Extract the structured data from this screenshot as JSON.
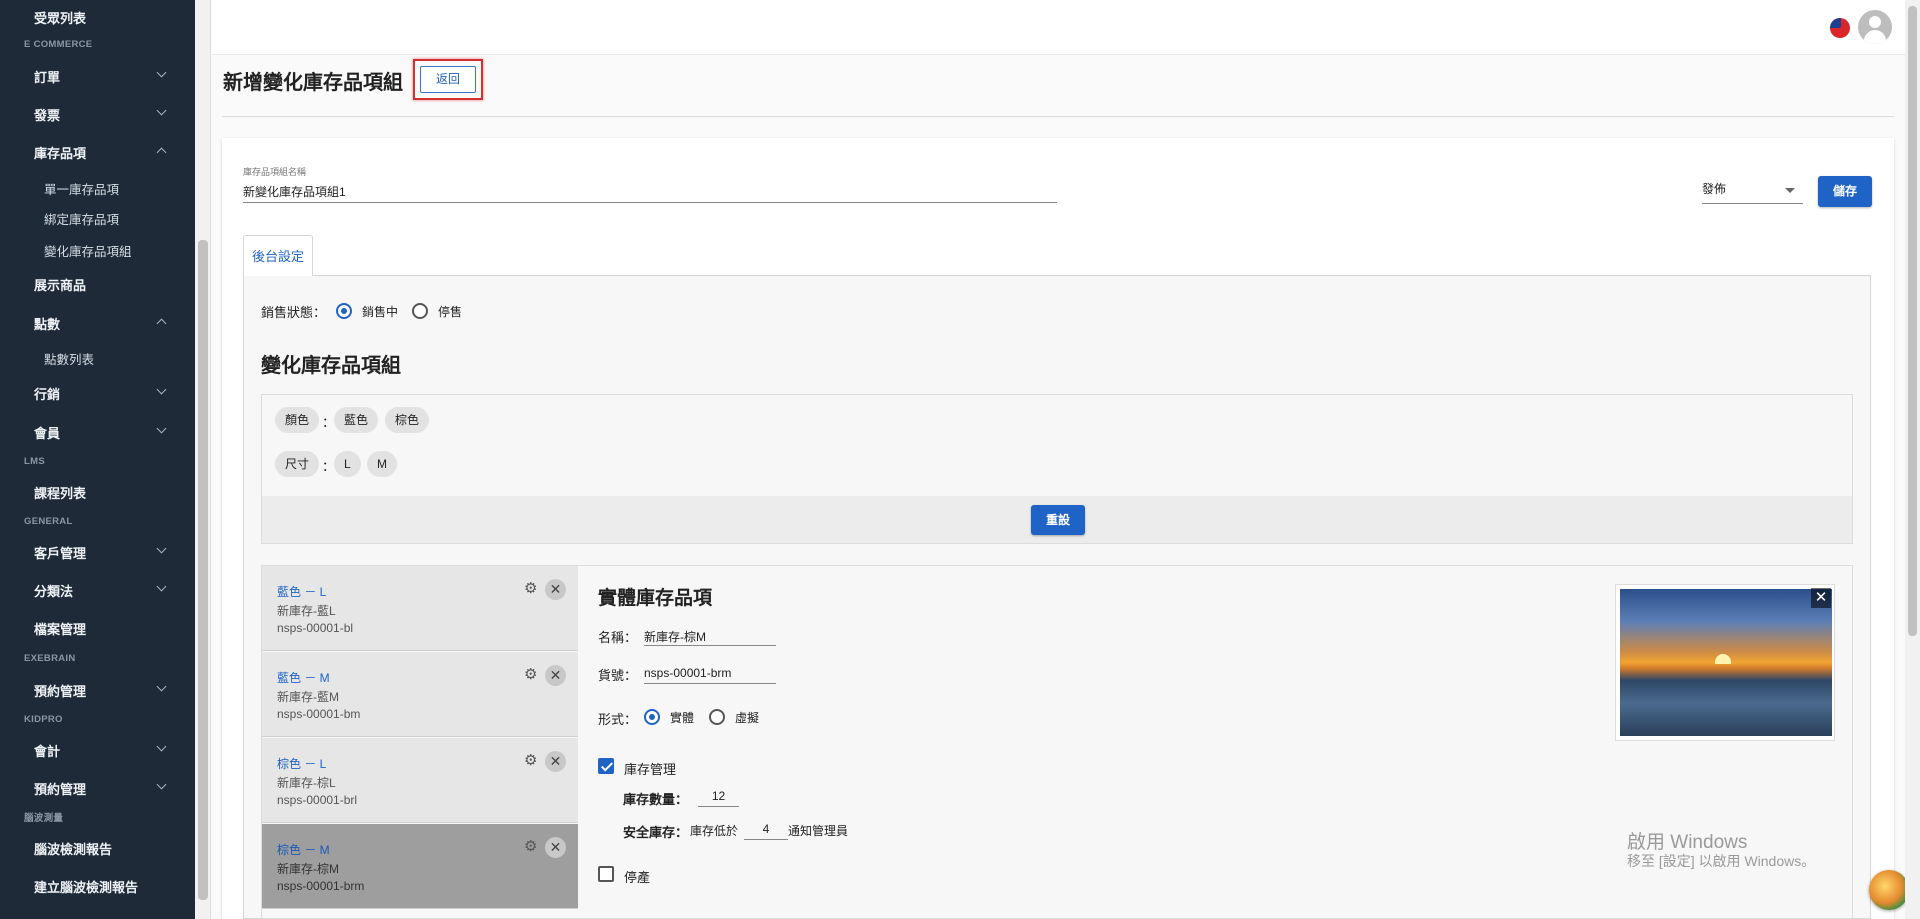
{
  "sidebar": {
    "items": [
      {
        "label": "受眾列表",
        "kind": "item"
      },
      {
        "label": "E COMMERCE",
        "kind": "section"
      },
      {
        "label": "訂單",
        "kind": "item",
        "chevron": "down"
      },
      {
        "label": "發票",
        "kind": "item",
        "chevron": "down"
      },
      {
        "label": "庫存品項",
        "kind": "item",
        "chevron": "up"
      },
      {
        "label": "單一庫存品項",
        "kind": "sub"
      },
      {
        "label": "綁定庫存品項",
        "kind": "sub"
      },
      {
        "label": "變化庫存品項組",
        "kind": "sub"
      },
      {
        "label": "展示商品",
        "kind": "item"
      },
      {
        "label": "點數",
        "kind": "item",
        "chevron": "up"
      },
      {
        "label": "點數列表",
        "kind": "sub"
      },
      {
        "label": "行銷",
        "kind": "item",
        "chevron": "down"
      },
      {
        "label": "會員",
        "kind": "item",
        "chevron": "down"
      },
      {
        "label": "LMS",
        "kind": "section"
      },
      {
        "label": "課程列表",
        "kind": "item"
      },
      {
        "label": "GENERAL",
        "kind": "section"
      },
      {
        "label": "客戶管理",
        "kind": "item",
        "chevron": "down"
      },
      {
        "label": "分類法",
        "kind": "item",
        "chevron": "down"
      },
      {
        "label": "檔案管理",
        "kind": "item"
      },
      {
        "label": "EXEBRAIN",
        "kind": "section"
      },
      {
        "label": "預約管理",
        "kind": "item",
        "chevron": "down"
      },
      {
        "label": "KIDPRO",
        "kind": "section"
      },
      {
        "label": "會計",
        "kind": "item",
        "chevron": "down"
      },
      {
        "label": "預約管理",
        "kind": "item",
        "chevron": "down"
      },
      {
        "label": "腦波測量",
        "kind": "section"
      },
      {
        "label": "腦波檢測報告",
        "kind": "item"
      },
      {
        "label": "建立腦波檢測報告",
        "kind": "item"
      }
    ]
  },
  "header": {
    "title": "新增變化庫存品項組",
    "back_label": "返回"
  },
  "form": {
    "name_label": "庫存品項組名稱",
    "name_value": "新變化庫存品項組1",
    "publish_value": "發佈",
    "save_label": "儲存",
    "tab_label": "後台設定",
    "sale_status_label": "銷售狀態：",
    "sale_options": [
      "銷售中",
      "停售"
    ],
    "sale_selected": 0
  },
  "variant_group": {
    "title": "變化庫存品項組",
    "attributes": [
      {
        "name": "顏色",
        "values": [
          "藍色",
          "棕色"
        ]
      },
      {
        "name": "尺寸",
        "values": [
          "L",
          "M"
        ]
      }
    ],
    "colon": "：",
    "reset_label": "重設"
  },
  "variants": [
    {
      "name": "藍色 － L",
      "title": "新庫存-藍L",
      "sku": "nsps-00001-bl",
      "selected": false
    },
    {
      "name": "藍色 － M",
      "title": "新庫存-藍M",
      "sku": "nsps-00001-bm",
      "selected": false
    },
    {
      "name": "棕色 － L",
      "title": "新庫存-棕L",
      "sku": "nsps-00001-brl",
      "selected": false
    },
    {
      "name": "棕色 － M",
      "title": "新庫存-棕M",
      "sku": "nsps-00001-brm",
      "selected": true
    }
  ],
  "detail": {
    "title": "實體庫存品項",
    "name_label": "名稱：",
    "name_value": "新庫存-棕M",
    "sku_label": "貨號：",
    "sku_value": "nsps-00001-brm",
    "form_label": "形式：",
    "form_options": [
      "實體",
      "虛擬"
    ],
    "form_selected": 0,
    "stock_mgmt_label": "庫存管理",
    "stock_qty_label": "庫存數量：",
    "stock_qty_value": "12",
    "safety_label": "安全庫存：",
    "safety_prefix": "庫存低於",
    "safety_value": "4",
    "safety_suffix": "通知管理員",
    "discontinued_label": "停產"
  },
  "watermark": {
    "line1": "啟用 Windows",
    "line2": "移至 [設定] 以啟用 Windows。"
  },
  "colors": {
    "sidebar_bg": "#1e2a38",
    "accent": "#1f63c6",
    "highlight_border": "#d32f2f"
  }
}
